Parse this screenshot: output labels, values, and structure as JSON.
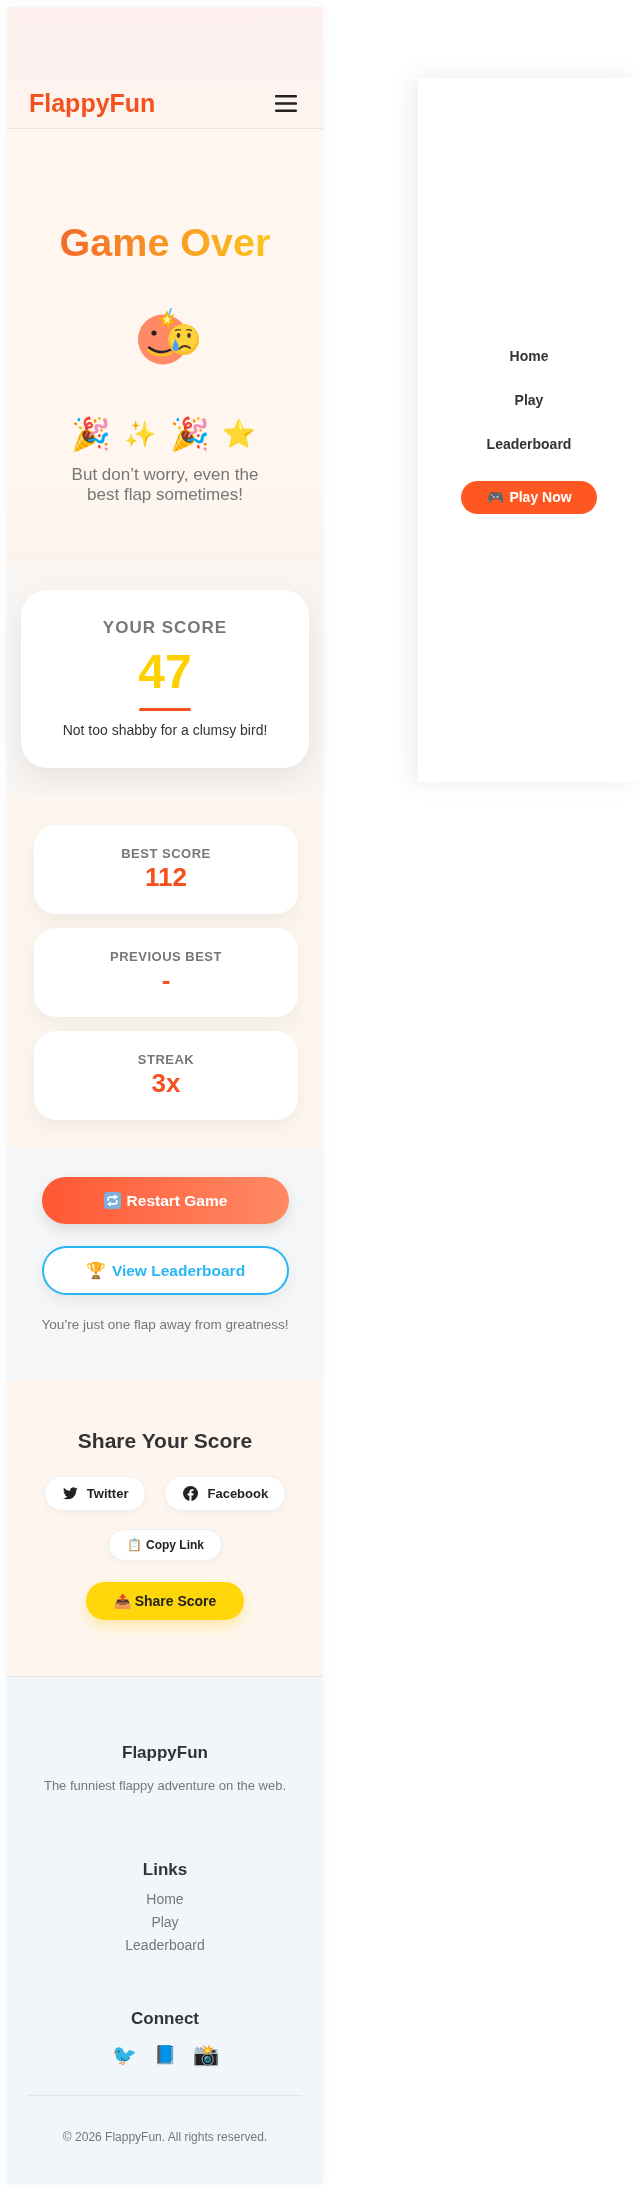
{
  "header": {
    "logo": "FlappyFun"
  },
  "side_menu": {
    "links": [
      "Home",
      "Play",
      "Leaderboard"
    ],
    "play_button": {
      "icon": "🎮",
      "label": "Play Now"
    }
  },
  "hero": {
    "title": "Game Over",
    "celebration": [
      {
        "kind": "popper",
        "glyph": "🎉"
      },
      {
        "kind": "sparkles",
        "glyph": "✨"
      },
      {
        "kind": "popper",
        "glyph": "🎉"
      },
      {
        "kind": "star",
        "glyph": "⭐"
      }
    ],
    "message": "But don’t worry, even the best flap sometimes!"
  },
  "score_card": {
    "label": "YOUR SCORE",
    "score": "47",
    "comment": "Not too shabby for a clumsy bird!"
  },
  "stats": [
    {
      "label": "BEST SCORE",
      "value": "112"
    },
    {
      "label": "PREVIOUS BEST",
      "value": "-"
    },
    {
      "label": "STREAK",
      "value": "3x"
    }
  ],
  "actions": {
    "restart_button": {
      "label": "Restart Game"
    },
    "leaderboard_button": {
      "icon": "🏆",
      "label": "View Leaderboard"
    },
    "tagline": "You’re just one flap away from greatness!"
  },
  "share": {
    "title": "Share Your Score",
    "social_buttons": [
      {
        "kind": "bird",
        "label": "Twitter"
      },
      {
        "kind": "circle-f",
        "label": "Facebook"
      }
    ],
    "copy_link_button": {
      "icon": "📋",
      "label": "Copy Link"
    },
    "share_button": {
      "icon": "📤",
      "label": "Share Score"
    }
  },
  "footer": {
    "brand": "FlappyFun",
    "tagline": "The funniest flappy adventure on the web.",
    "links_title": "Links",
    "links": [
      "Home",
      "Play",
      "Leaderboard"
    ],
    "connect_title": "Connect",
    "social_icons": [
      {
        "kind": "bird",
        "glyph": "🐦"
      },
      {
        "kind": "book",
        "glyph": "📘"
      },
      {
        "kind": "camera",
        "glyph": "📸"
      }
    ],
    "copyright": "© 2026 FlappyFun. All rights reserved."
  }
}
